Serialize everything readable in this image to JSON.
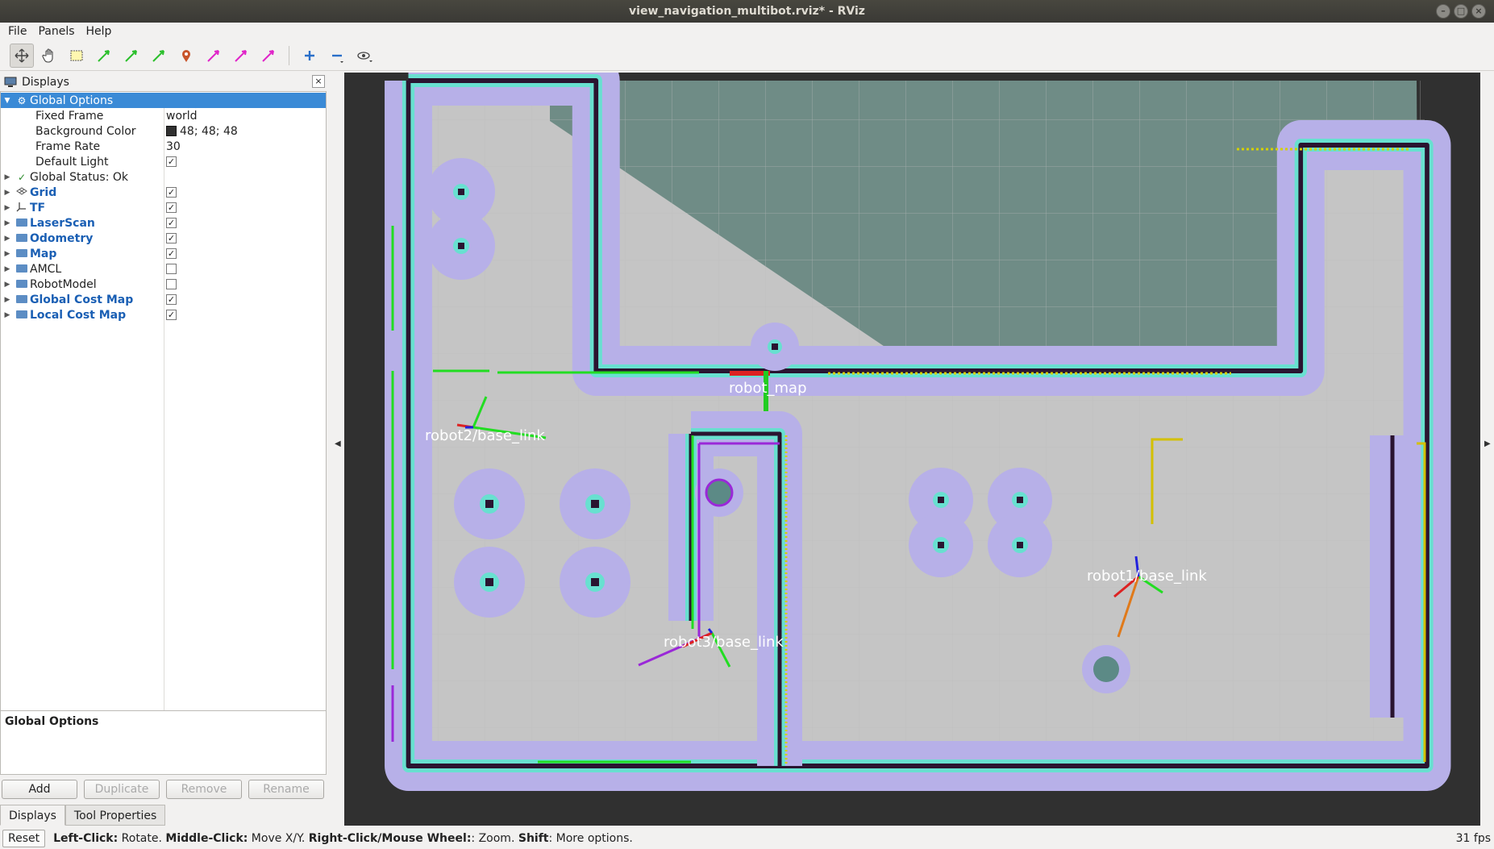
{
  "window": {
    "title": "view_navigation_multibot.rviz* - RViz"
  },
  "menu": [
    "File",
    "Panels",
    "Help"
  ],
  "toolbar": {
    "tools": [
      "move-camera-icon",
      "interact-icon",
      "select-icon",
      "2d-pose-estimate-icon",
      "2d-nav-goal-icon",
      "2d-nav-goal-icon",
      "publish-point-icon",
      "2d-pose-estimate-icon",
      "2d-nav-goal-icon",
      "2d-nav-goal-icon",
      "add-tool-icon",
      "remove-tool-icon",
      "camera-view-icon"
    ]
  },
  "displays_panel": {
    "title": "Displays",
    "global_options": {
      "label": "Global Options",
      "props": [
        {
          "name": "Fixed Frame",
          "value": "world"
        },
        {
          "name": "Background Color",
          "value": "48; 48; 48"
        },
        {
          "name": "Frame Rate",
          "value": "30"
        },
        {
          "name": "Default Light",
          "checked": "✓"
        }
      ]
    },
    "global_status": "Global Status: Ok",
    "items": [
      {
        "label": "Grid",
        "checked": "✓",
        "bold": true
      },
      {
        "label": "TF",
        "checked": "✓",
        "bold": true
      },
      {
        "label": "LaserScan",
        "checked": "✓",
        "bold": true
      },
      {
        "label": "Odometry",
        "checked": "✓",
        "bold": true
      },
      {
        "label": "Map",
        "checked": "✓",
        "bold": true
      },
      {
        "label": "AMCL",
        "checked": "",
        "bold": false
      },
      {
        "label": "RobotModel",
        "checked": "",
        "bold": false
      },
      {
        "label": "Global Cost Map",
        "checked": "✓",
        "bold": true
      },
      {
        "label": "Local Cost Map",
        "checked": "✓",
        "bold": true
      }
    ],
    "description_title": "Global Options",
    "buttons": {
      "add": "Add",
      "duplicate": "Duplicate",
      "remove": "Remove",
      "rename": "Rename"
    },
    "tabs": {
      "displays": "Displays",
      "tool_properties": "Tool Properties"
    }
  },
  "viewport": {
    "background_color": "#303030",
    "robot_labels": {
      "robot2": "robot2/base_link",
      "robot1": "robot1/base_link",
      "robot3": "robot3/base_link",
      "overlapped": "robot_map"
    }
  },
  "status_bar": {
    "reset": "Reset",
    "left_click_key": "Left-Click:",
    "left_click_text": " Rotate. ",
    "middle_click_key": "Middle-Click:",
    "middle_click_text": " Move X/Y. ",
    "right_click_key": "Right-Click/Mouse Wheel:",
    "right_click_text": ": Zoom. ",
    "shift_key": "Shift",
    "shift_text": ": More options.",
    "fps": "31 fps"
  }
}
